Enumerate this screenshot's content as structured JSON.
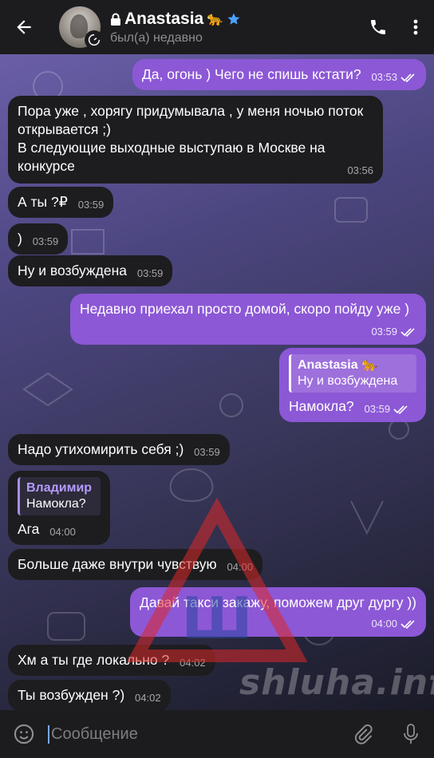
{
  "header": {
    "contact_name": "Anastasia",
    "name_emoji": "🐆",
    "status": "был(а) недавно",
    "icons": [
      "back-arrow-icon",
      "lock-icon",
      "leopard-emoji-icon",
      "star-icon",
      "phone-icon",
      "more-vert-icon"
    ]
  },
  "messages": [
    {
      "dir": "out",
      "text": "Да, огонь ) Чего не спишь кстати?",
      "time": "03:53",
      "read": true
    },
    {
      "dir": "in",
      "text": "Пора уже , хорягу придумывала , у меня ночью поток открывается ;)\nВ следующие выходные выступаю в Москве на конкурсе",
      "time": "03:56"
    },
    {
      "dir": "in",
      "text": "А ты ?₽",
      "time": "03:59"
    },
    {
      "dir": "in",
      "text": ")",
      "time": "03:59"
    },
    {
      "dir": "in",
      "text": "Ну и возбуждена",
      "time": "03:59"
    },
    {
      "dir": "out",
      "text": "Недавно приехал просто домой, скоро пойду уже )",
      "time": "03:59",
      "read": true
    },
    {
      "dir": "out",
      "reply_name": "Anastasia 🐆",
      "reply_text": "Ну и возбуждена",
      "text": "Намокла?",
      "time": "03:59",
      "read": true
    },
    {
      "dir": "in",
      "text": "Надо утихомирить себя ;)",
      "time": "03:59"
    },
    {
      "dir": "in",
      "reply_name": "Владимир",
      "reply_text": "Намокла?",
      "text": "Ага",
      "time": "04:00"
    },
    {
      "dir": "in",
      "text": "Больше даже внутри чувствую",
      "time": "04:00"
    },
    {
      "dir": "out",
      "text": "Давай такси закажу, поможем друг дургу ))",
      "time": "04:00",
      "read": true
    },
    {
      "dir": "in",
      "text": "Хм а ты где локально ?",
      "time": "04:02"
    },
    {
      "dir": "in",
      "text": "Ты возбужден ?)",
      "time": "04:02"
    }
  ],
  "input": {
    "placeholder": "Сообщение"
  },
  "watermark": {
    "text": "shluha.info",
    "logo_letter": "Ш"
  },
  "colors": {
    "outgoing": "#8c58d6",
    "incoming": "#1d1d20",
    "bar": "#1c1c1e",
    "accent_star": "#4aa3ff"
  }
}
